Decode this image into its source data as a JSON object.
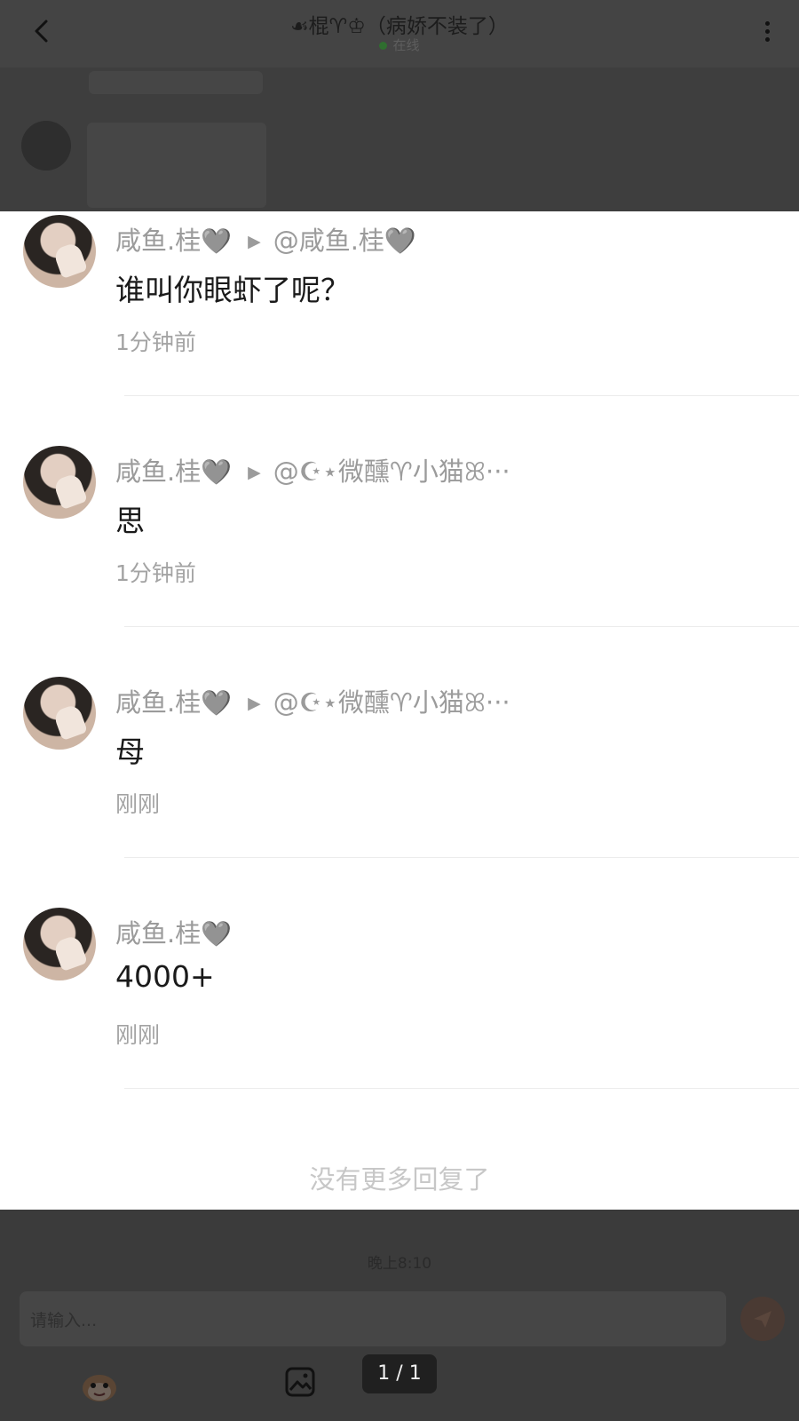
{
  "header": {
    "title": "☙棍♈♔（病娇不装了）",
    "status": "在线"
  },
  "replies": [
    {
      "author": "咸鱼.桂",
      "heart": "🩶",
      "target": "@咸鱼.桂🩶",
      "text": "谁叫你眼虾了呢？",
      "time": "1分钟前"
    },
    {
      "author": "咸鱼.桂",
      "heart": "🩶",
      "target": "@☪⋆微醺♈小猫ꕤ···",
      "text": "思",
      "time": "1分钟前"
    },
    {
      "author": "咸鱼.桂",
      "heart": "🩶",
      "target": "@☪⋆微醺♈小猫ꕤ···",
      "text": "母",
      "time": "刚刚"
    },
    {
      "author": "咸鱼.桂",
      "heart": "🩶",
      "target": "",
      "text": "4000+",
      "time": "刚刚"
    }
  ],
  "no_more": "没有更多回复了",
  "footer": {
    "timestamp": "晚上8:10",
    "input_placeholder": "请输入...",
    "page_counter": "1 / 1"
  },
  "icons": [
    "back-icon",
    "more-icon",
    "send-icon",
    "face-emoji-icon",
    "image-icon"
  ]
}
